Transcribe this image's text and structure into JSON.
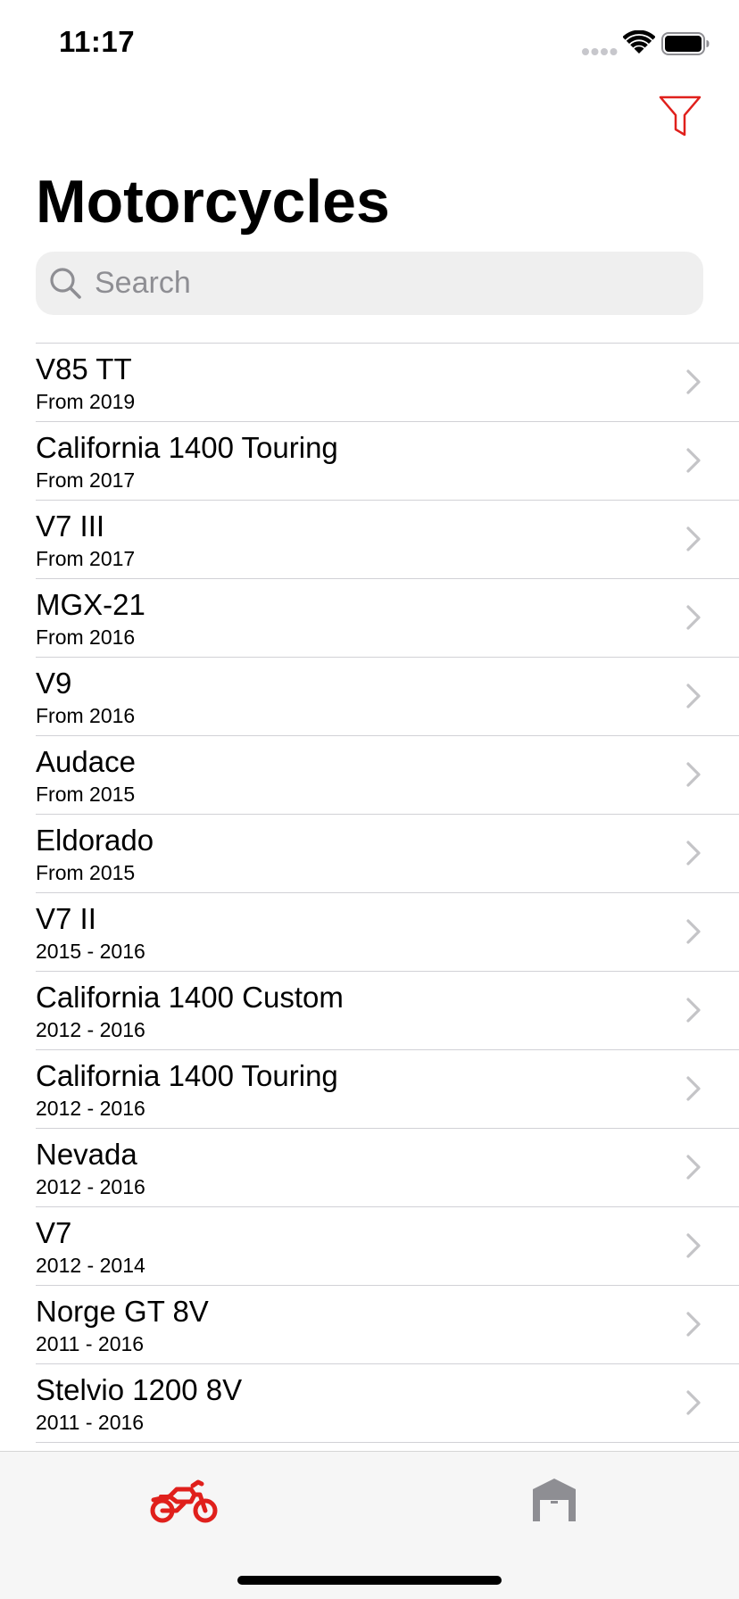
{
  "status_bar": {
    "time": "11:17"
  },
  "header": {
    "title": "Motorcycles",
    "filter_icon": "funnel-icon"
  },
  "search": {
    "placeholder": "Search",
    "value": ""
  },
  "motorcycles": [
    {
      "name": "V85 TT",
      "years": "From 2019"
    },
    {
      "name": "California 1400 Touring",
      "years": "From 2017"
    },
    {
      "name": "V7 III",
      "years": "From 2017"
    },
    {
      "name": "MGX-21",
      "years": "From 2016"
    },
    {
      "name": "V9",
      "years": "From 2016"
    },
    {
      "name": "Audace",
      "years": "From 2015"
    },
    {
      "name": "Eldorado",
      "years": "From 2015"
    },
    {
      "name": "V7 II",
      "years": "2015 - 2016"
    },
    {
      "name": "California 1400 Custom",
      "years": "2012 - 2016"
    },
    {
      "name": "California 1400 Touring",
      "years": "2012 - 2016"
    },
    {
      "name": "Nevada",
      "years": "2012 - 2016"
    },
    {
      "name": "V7",
      "years": "2012 - 2014"
    },
    {
      "name": "Norge GT 8V",
      "years": "2011 - 2016"
    },
    {
      "name": "Stelvio 1200 8V",
      "years": "2011 - 2016"
    }
  ],
  "tab_bar": {
    "tabs": [
      {
        "icon": "motorcycle-icon",
        "selected": true
      },
      {
        "icon": "garage-icon",
        "selected": false
      }
    ]
  },
  "colors": {
    "accent": "#e0201c",
    "inactive_tab": "#8e8e93",
    "separator": "#d1d1d6",
    "chevron": "#c4c4c7",
    "search_bg": "#efefef"
  }
}
